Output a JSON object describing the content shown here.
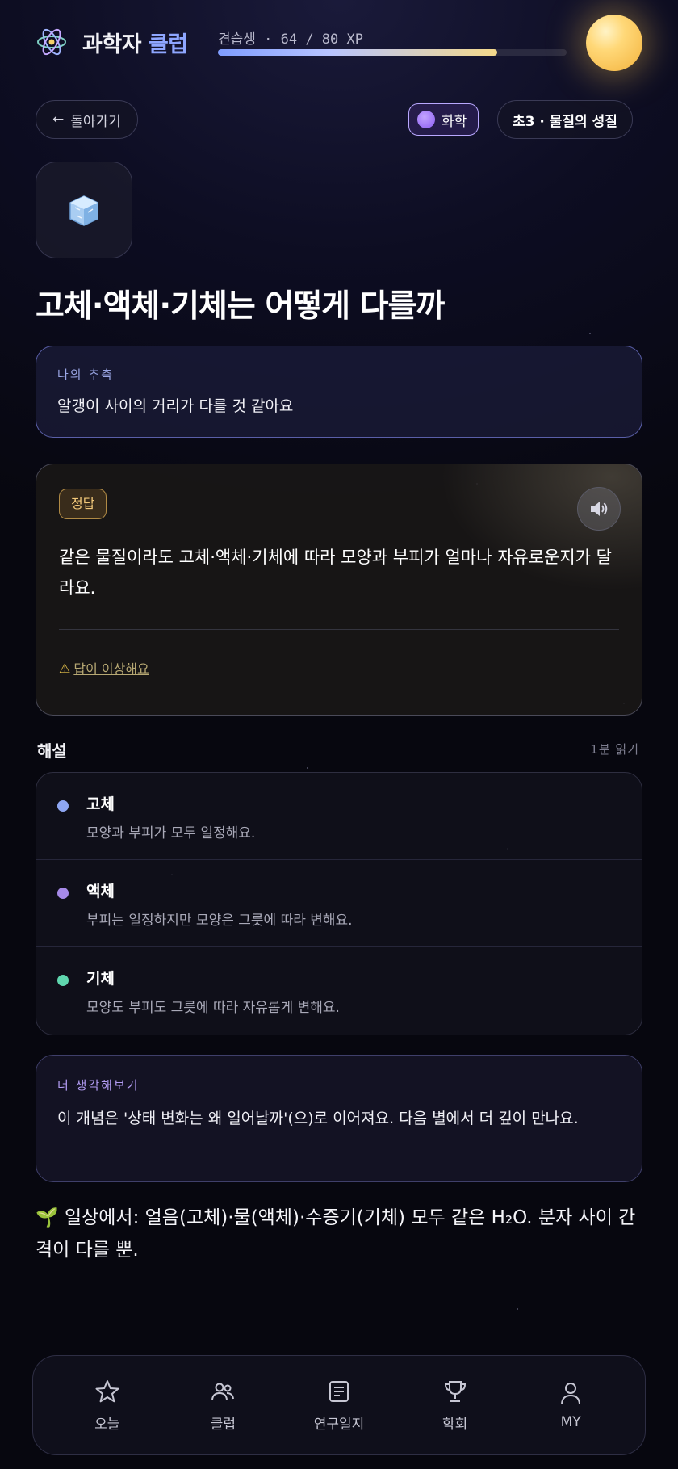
{
  "header": {
    "brand_main": "과학자",
    "brand_accent": "클럽",
    "xp_label": "견습생 · 64 / 80 XP",
    "xp_progress": 0.8
  },
  "top_row": {
    "back_label": "돌아가기",
    "subject_label": "화학",
    "unit_label": "초3 · 물질의 성질"
  },
  "topic": {
    "title": "고체·액체·기체는 어떻게 다를까"
  },
  "guess": {
    "label": "나의 추측",
    "text": "알갱이 사이의 거리가 다를 것 같아요"
  },
  "answer": {
    "badge": "정답",
    "text": "같은 물질이라도 고체·액체·기체에 따라 모양과 부피가 얼마나 자유로운지가 달라요.",
    "report_label": "답이 이상해요"
  },
  "explanation": {
    "title": "해설",
    "read_time": "1분 읽기",
    "items": [
      {
        "name": "고체",
        "desc": "모양과 부피가 모두 일정해요.",
        "color": "#8ea6f2"
      },
      {
        "name": "액체",
        "desc": "부피는 일정하지만 모양은 그릇에 따라 변해요.",
        "color": "#a68ae8"
      },
      {
        "name": "기체",
        "desc": "모양도 부피도 그릇에 따라 자유롭게 변해요.",
        "color": "#5fd6ae"
      }
    ]
  },
  "think_more": {
    "label": "더 생각해보기",
    "text": "이 개념은 '상태 변화는 왜 일어날까'(으)로 이어져요. 다음 별에서 더 깊이 만나요."
  },
  "daily": {
    "text": "🌱 일상에서: 얼음(고체)·물(액체)·수증기(기체) 모두 같은 H₂O. 분자 사이 간격이 다를 뿐."
  },
  "nav": {
    "items": [
      {
        "label": "오늘",
        "icon": "star-icon"
      },
      {
        "label": "클럽",
        "icon": "users-icon"
      },
      {
        "label": "연구일지",
        "icon": "journal-icon"
      },
      {
        "label": "학회",
        "icon": "trophy-icon"
      },
      {
        "label": "MY",
        "icon": "user-icon"
      }
    ]
  },
  "colors": {
    "accent": "#8ea6ff",
    "answer_badge": "#f3c97a",
    "subject": "#b9a8ff"
  }
}
